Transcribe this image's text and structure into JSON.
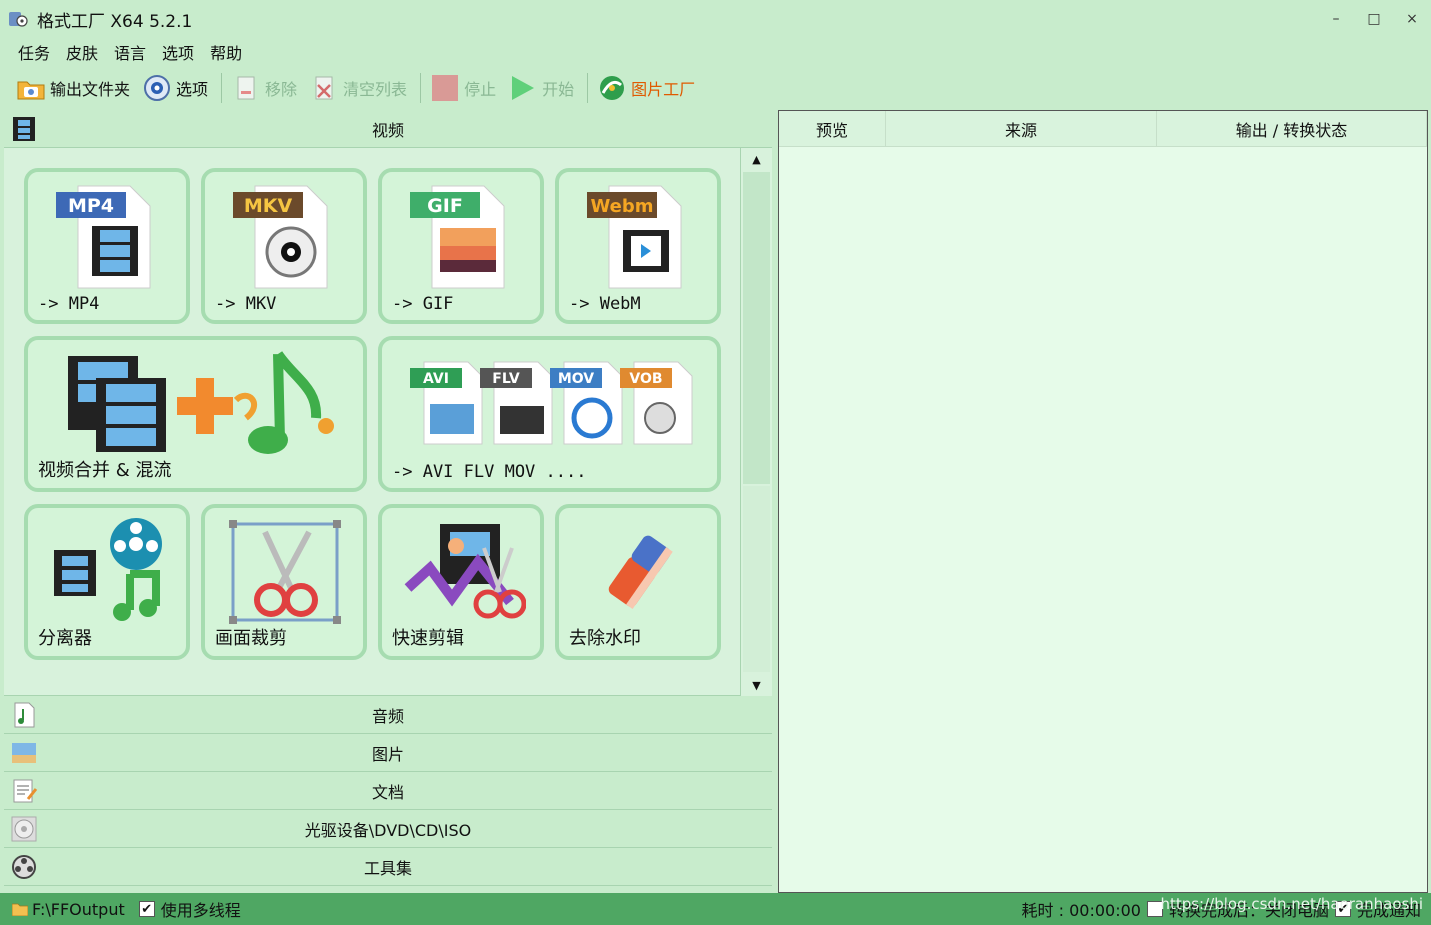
{
  "window": {
    "title": "格式工厂 X64 5.2.1",
    "minimize": "–",
    "maximize": "□",
    "close": "×"
  },
  "menu": [
    "任务",
    "皮肤",
    "语言",
    "选项",
    "帮助"
  ],
  "toolbar": {
    "output_folder": "输出文件夹",
    "options": "选项",
    "remove": "移除",
    "clear_list": "清空列表",
    "stop": "停止",
    "start": "开始",
    "picture_factory": "图片工厂"
  },
  "categories": {
    "video": "视频",
    "audio": "音频",
    "picture": "图片",
    "document": "文档",
    "disc": "光驱设备\\DVD\\CD\\ISO",
    "tools": "工具集"
  },
  "video_tiles": {
    "mp4": {
      "badge": "MP4",
      "label": "-> MP4"
    },
    "mkv": {
      "badge": "MKV",
      "label": "-> MKV"
    },
    "gif": {
      "badge": "GIF",
      "label": "-> GIF"
    },
    "webm": {
      "badge": "Webm",
      "label": "-> WebM"
    },
    "merge": {
      "label": "视频合并 & 混流"
    },
    "others": {
      "badges": [
        "AVI",
        "FLV",
        "MOV",
        "VOB"
      ],
      "label": "-> AVI FLV MOV ...."
    },
    "splitter": {
      "label": "分离器"
    },
    "crop": {
      "label": "画面裁剪"
    },
    "quick_cut": {
      "label": "快速剪辑"
    },
    "watermark": {
      "label": "去除水印"
    }
  },
  "task_table": {
    "columns": [
      "预览",
      "来源",
      "输出 / 转换状态"
    ]
  },
  "status": {
    "output_path": "F:\\FFOutput",
    "multithread_label": "使用多线程",
    "multithread_checked": "✔",
    "elapsed": "耗时 : 00:00:00",
    "after_convert": "转换完成后：关闭电脑",
    "notify": "完成通知",
    "notify_checked": "✔",
    "watermark_text": "https://blog.csdn.net/haoranhaoshi"
  },
  "colors": {
    "window_bg": "#c8eccc",
    "status_bg": "#4fa763",
    "accent_orange": "#e05a00"
  }
}
